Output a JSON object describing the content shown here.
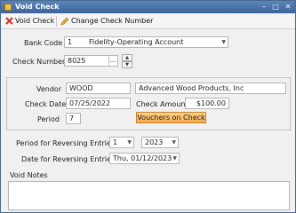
{
  "window": {
    "title": "Void Check"
  },
  "toolbar": {
    "void_check_label": "Void Check",
    "change_check_number_label": "Change Check Number"
  },
  "form": {
    "bank_code_label": "Bank Code",
    "bank_code_value": "1",
    "bank_name_value": "Fidelity-Operating Account",
    "check_number_label": "Check Number",
    "check_number_value": "8025",
    "vendor_label": "Vendor",
    "vendor_code_value": "WOOD",
    "vendor_name_value": "Advanced Wood Products, Inc",
    "check_date_label": "Check Date",
    "check_date_value": "07/25/2022",
    "check_amount_label": "Check Amount",
    "check_amount_value": "$100.00",
    "period_label": "Period",
    "period_value": "7",
    "vouchers_button_label": "Vouchers on Check",
    "period_reversing_label": "Period for Reversing Entries",
    "period_reversing_value": "1",
    "year_reversing_value": "2023",
    "date_reversing_label": "Date for Reversing Entries",
    "date_reversing_value": "Thu, 01/12/2023",
    "void_notes_label": "Void Notes",
    "void_notes_value": ""
  },
  "colors": {
    "title_bar": "#3d6499",
    "accent_button": "#f3a94c",
    "void_icon": "#d0342c",
    "pencil_icon": "#e8a73a"
  }
}
